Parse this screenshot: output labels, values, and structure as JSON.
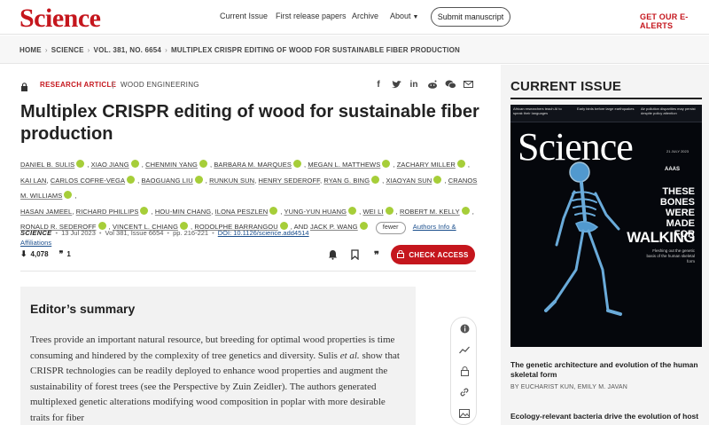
{
  "nav": {
    "logo": "Science",
    "links": [
      "Current Issue",
      "First release papers",
      "Archive",
      "About"
    ],
    "submit": "Submit manuscript",
    "ealerts": "GET OUR E-ALERTS"
  },
  "breadcrumb": [
    "HOME",
    "SCIENCE",
    "VOL. 381, NO. 6654",
    "MULTIPLEX CRISPR EDITING OF WOOD FOR SUSTAINABLE FIBER PRODUCTION"
  ],
  "article": {
    "type": "RESEARCH ARTICLE",
    "subject": "WOOD ENGINEERING",
    "title": "Multiplex CRISPR editing of wood for sustainable fiber production",
    "authors": [
      "DANIEL B. SULIS",
      "XIAO JIANG",
      "CHENMIN YANG",
      "BARBARA M. MARQUES",
      "MEGAN L. MATTHEWS",
      "ZACHARY MILLER",
      "KAI LAN",
      "CARLOS COFRE-VEGA",
      "BAOGUANG LIU",
      "RUNKUN SUN",
      "HENRY SEDEROFF",
      "RYAN G. BING",
      "XIAOYAN SUN",
      "CRANOS M. WILLIAMS",
      "HASAN JAMEEL",
      "RICHARD PHILLIPS",
      "HOU-MIN CHANG",
      "ILONA PESZLEN",
      "YUNG-YUN HUANG",
      "WEI LI",
      "ROBERT M. KELLY",
      "RONALD R. SEDEROFF",
      "VINCENT L. CHIANG",
      "RODOLPHE BARRANGOU",
      "JACK P. WANG"
    ],
    "and_label": ", AND",
    "fewer": "fewer",
    "affiliations": "Authors Info & Affiliations",
    "journal": "SCIENCE",
    "date": "13 Jul 2023",
    "volume": "Vol 381, Issue 6654",
    "pages": "pp. 216-221",
    "doi": "DOI: 10.1126/science.add4514",
    "downloads": "4,078",
    "citations": "1",
    "check_access": "CHECK ACCESS"
  },
  "summary": {
    "heading": "Editor’s summary",
    "text_before": "Trees provide an important natural resource, but breeding for optimal wood properties is time consuming and hindered by the complexity of tree genetics and diversity. Sulis ",
    "text_italic": "et al.",
    "text_after": " show that CRISPR technologies can be readily deployed to enhance wood properties and augment the sustainability of forest trees (see the Perspective by Zuin Zeidler). The authors generated multiplexed genetic alterations modifying wood composition in poplar with more desirable traits for fiber"
  },
  "sidebar": {
    "title": "CURRENT ISSUE",
    "cover": {
      "strip": [
        "African researchers teach AI to speak their languages",
        "Early birds before large earthquakes",
        "Air pollution disparities may persist despite policy attention"
      ],
      "logo": "Science",
      "issue": "21 JULY 2023",
      "publisher": "AAAS",
      "headline1": "THESE BONES WERE MADE FOR",
      "headline2": "WALKING",
      "sub": "Fleshing out the genetic basis of the human skeletal form"
    },
    "article1": "The genetic architecture and evolution of the human skeletal form",
    "byline": "BY EUCHARIST KUN, EMILY M. JAVAN",
    "article2": "Ecology-relevant bacteria drive the evolution of host"
  }
}
